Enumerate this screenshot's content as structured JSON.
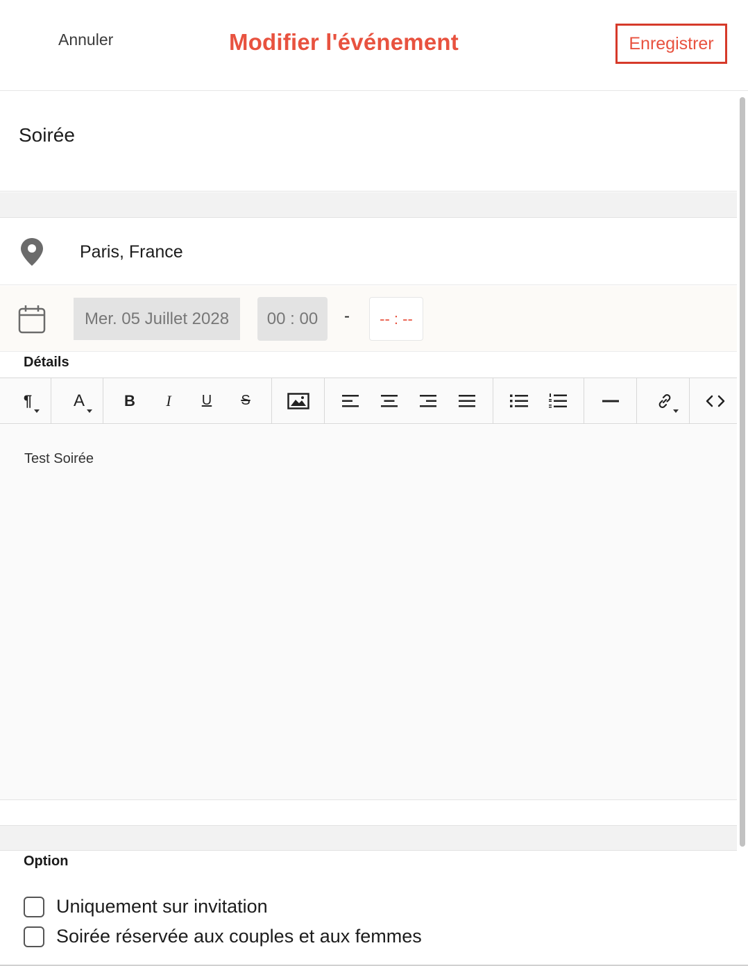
{
  "header": {
    "cancel_label": "Annuler",
    "title": "Modifier l'événement",
    "save_label": "Enregistrer"
  },
  "event": {
    "name": "Soirée",
    "location": "Paris, France",
    "date": "Mer. 05 Juillet 2028",
    "start_time": "00 : 00",
    "separator": "-",
    "end_time": "-- : --"
  },
  "details": {
    "label": "Détails",
    "content": "Test Soirée"
  },
  "toolbar": {
    "paragraph": "¶",
    "font_color": "A",
    "bold": "B",
    "italic": "I",
    "underline": "U",
    "strike": "S"
  },
  "options": {
    "label": "Option",
    "items": [
      {
        "label": "Uniquement sur invitation",
        "checked": false
      },
      {
        "label": "Soirée réservée aux couples et aux femmes",
        "checked": false
      }
    ]
  },
  "colors": {
    "accent": "#e8523f",
    "save_border": "#d63a2a"
  }
}
